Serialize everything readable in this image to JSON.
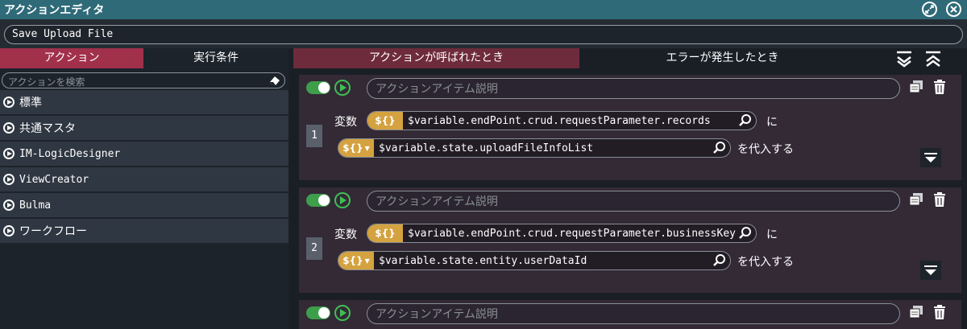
{
  "window": {
    "title": "アクションエディタ",
    "buttons": {
      "restore": "restore",
      "close": "close"
    }
  },
  "action_name": "Save Upload File",
  "left_panel": {
    "tabs": [
      "アクション",
      "実行条件"
    ],
    "search_placeholder": "アクションを検索",
    "categories": [
      "標準",
      "共通マスタ",
      "IM-LogicDesigner",
      "ViewCreator",
      "Bulma",
      "ワークフロー"
    ]
  },
  "right_panel": {
    "tabs": [
      "アクションが呼ばれたとき",
      "エラーが発生したとき"
    ],
    "cards": [
      {
        "index": "1",
        "description_placeholder": "アクションアイテム説明",
        "var_label": "変数",
        "var_chip": "${}",
        "var_value": "$variable.endPoint.crud.requestParameter.records",
        "ni_label": "に",
        "assign_chip": "${}",
        "assign_value": "$variable.state.uploadFileInfoList",
        "assign_label": "を代入する"
      },
      {
        "index": "2",
        "description_placeholder": "アクションアイテム説明",
        "var_label": "変数",
        "var_chip": "${}",
        "var_value": "$variable.endPoint.crud.requestParameter.businessKey",
        "ni_label": "に",
        "assign_chip": "${}",
        "assign_value": "$variable.state.entity.userDataId",
        "assign_label": "を代入する"
      },
      {
        "description_placeholder": "アクションアイテム説明"
      }
    ]
  },
  "colors": {
    "titlebar": "#2f6a78",
    "left_tab_active": "#a1304b",
    "right_tab_active": "#6e2b3c",
    "chip": "#d4a23f",
    "toggle_on": "#3d9e4b"
  }
}
